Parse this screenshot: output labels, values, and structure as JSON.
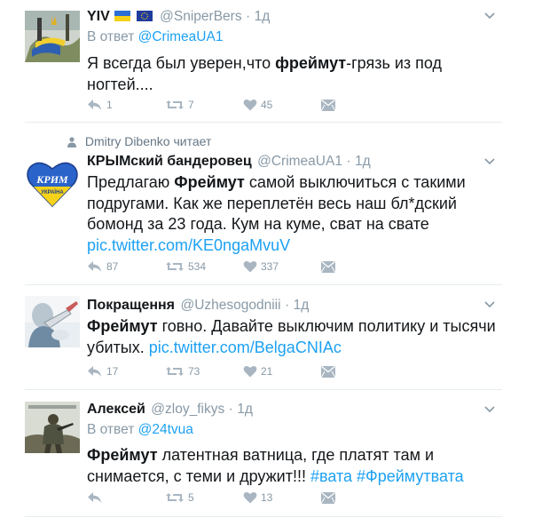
{
  "tweets": [
    {
      "name": "YIV",
      "handle": "@SniperBers",
      "time": "1д",
      "reply_prefix": "В ответ",
      "reply_to": "@CrimeaUA1",
      "text_bold": "фреймут",
      "text_before": "Я всегда был уверен,что ",
      "text_after": "-грязь из под ногтей....",
      "counts": {
        "replies": "1",
        "retweets": "7",
        "likes": "45"
      }
    },
    {
      "context": "Dmitry Dibenko читает",
      "name": "КРЫМский бандеровец",
      "handle": "@CrimeaUA1",
      "time": "1д",
      "avatar_text_1": "КРИМ",
      "avatar_text_2": "УКРАЇНА",
      "text_before": "Предлагаю ",
      "text_bold": "Фреймут",
      "text_after": " самой выключиться с такими подругами. Как же переплетён весь наш бл*дский бомонд за 23 года. Кум на куме, сват на свате",
      "link": "pic.twitter.com/KE0ngaMvuV",
      "counts": {
        "replies": "87",
        "retweets": "534",
        "likes": "337"
      }
    },
    {
      "name": "Покращення",
      "handle": "@Uzhesogodniii",
      "time": "1д",
      "text_bold": "Фреймут",
      "text_after": " говно. Давайте выключим политику и тысячи убитых. ",
      "link": "pic.twitter.com/BelgaCNIAc",
      "counts": {
        "replies": "17",
        "retweets": "73",
        "likes": "21"
      }
    },
    {
      "name": "Алексей",
      "handle": "@zloy_fikys",
      "time": "1д",
      "reply_prefix": "В ответ",
      "reply_to": "@24tvua",
      "text_bold": "Фреймут",
      "text_after": " латентная ватница, где платят там и снимается, с теми и дружит!!! ",
      "hashtags": "#вата #Фреймутвата",
      "counts": {
        "replies": "",
        "retweets": "5",
        "likes": "13"
      }
    }
  ],
  "colors": {
    "link": "#1da1f2",
    "muted": "#8899a6",
    "divider": "#e6ecf0"
  }
}
